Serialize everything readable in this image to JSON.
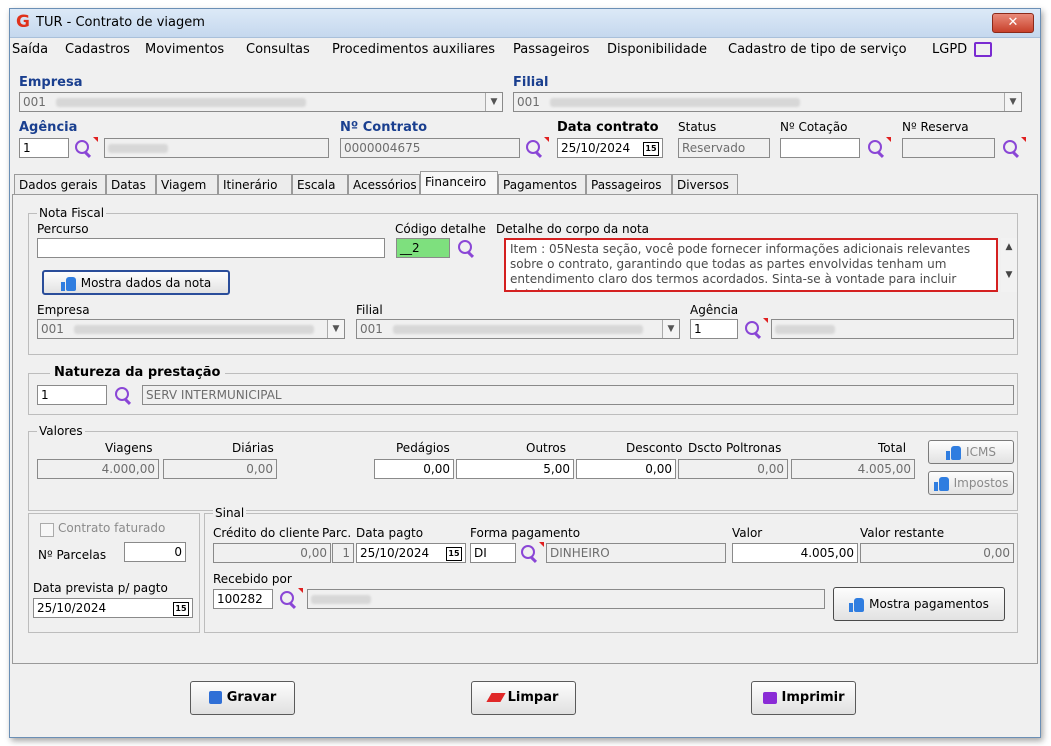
{
  "window": {
    "title": "TUR - Contrato de viagem",
    "close_label": "✕"
  },
  "menu": {
    "items": [
      "Saída",
      "Cadastros",
      "Movimentos",
      "Consultas",
      "Procedimentos auxiliares",
      "Passageiros",
      "Disponibilidade",
      "Cadastro de tipo de serviço",
      "LGPD"
    ]
  },
  "header": {
    "empresa_label": "Empresa",
    "empresa_code": "001",
    "filial_label": "Filial",
    "filial_code": "001",
    "agencia_label": "Agência",
    "agencia_code": "1",
    "contrato_label": "Nº Contrato",
    "contrato_value": "0000004675",
    "data_contrato_label": "Data contrato",
    "data_contrato_value": "25/10/2024",
    "status_label": "Status",
    "status_value": "Reservado",
    "cotacao_label": "Nº Cotação",
    "reserva_label": "Nº Reserva"
  },
  "tabs": [
    "Dados gerais",
    "Datas",
    "Viagem",
    "Itinerário",
    "Escala",
    "Acessórios",
    "Financeiro",
    "Pagamentos",
    "Passageiros",
    "Diversos"
  ],
  "active_tab": "Financeiro",
  "nota_fiscal": {
    "title": "Nota Fiscal",
    "percurso_label": "Percurso",
    "percurso_value": "",
    "codigo_detalhe_label": "Código detalhe",
    "codigo_detalhe_value": "__2",
    "detalhe_label": "Detalhe do corpo da nota",
    "detalhe_text": "Item : 05Nesta seção, você pode fornecer informações adicionais relevantes sobre o contrato, garantindo que todas as partes envolvidas tenham um entendimento claro dos termos acordados. Sinta-se à vontade para incluir detalhes",
    "mostra_button": "Mostra dados da nota",
    "empresa_label": "Empresa",
    "empresa_code": "001",
    "filial_label": "Filial",
    "filial_code": "001",
    "agencia_label": "Agência",
    "agencia_code": "1"
  },
  "natureza": {
    "title": "Natureza da prestação",
    "code": "1",
    "description": "SERV INTERMUNICIPAL"
  },
  "valores": {
    "title": "Valores",
    "viagens_label": "Viagens",
    "viagens_value": "4.000,00",
    "diarias_label": "Diárias",
    "diarias_value": "0,00",
    "pedagios_label": "Pedágios",
    "pedagios_value": "0,00",
    "outros_label": "Outros",
    "outros_value": "5,00",
    "desconto_label": "Desconto",
    "desconto_value": "0,00",
    "dscto_label": "Dscto Poltronas",
    "dscto_value": "0,00",
    "total_label": "Total",
    "total_value": "4.005,00",
    "icms_button": "ICMS",
    "impostos_button": "Impostos"
  },
  "faturamento": {
    "contrato_faturado_label": "Contrato faturado",
    "parcelas_label": "Nº Parcelas",
    "parcelas_value": "0",
    "data_prevista_label": "Data prevista p/ pagto",
    "data_prevista_value": "25/10/2024"
  },
  "sinal": {
    "title": "Sinal",
    "credito_label": "Crédito do cliente",
    "credito_value": "0,00",
    "parc_label": "Parc.",
    "parc_value": "1",
    "data_pagto_label": "Data pagto",
    "data_pagto_value": "25/10/2024",
    "forma_label": "Forma pagamento",
    "forma_code": "DI",
    "forma_desc": "DINHEIRO",
    "valor_label": "Valor",
    "valor_value": "4.005,00",
    "restante_label": "Valor restante",
    "restante_value": "0,00",
    "recebido_label": "Recebido por",
    "recebido_value": "100282",
    "mostra_pagamentos_button": "Mostra pagamentos"
  },
  "actions": {
    "gravar": "Gravar",
    "limpar": "Limpar",
    "imprimir": "Imprimir"
  },
  "colors": {
    "accent": "#1a3f8f",
    "highlight_green": "#7ee07e",
    "alert_red": "#d42020",
    "icon_purple": "#8a46d6"
  }
}
